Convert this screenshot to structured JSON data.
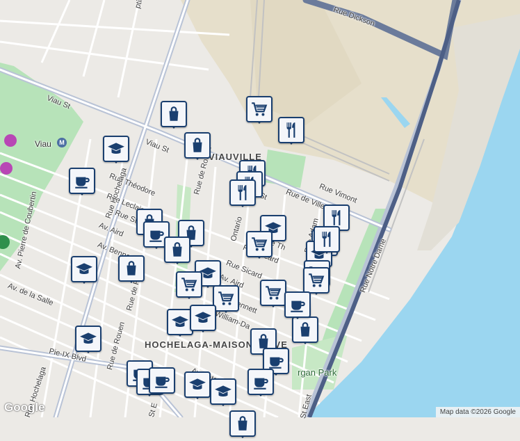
{
  "map": {
    "district_labels": [
      "VIAUVILLE",
      "HOCHELAGA-MAISONNEUVE"
    ],
    "metro_station": "Viau",
    "metro_badge": "M",
    "street_labels": [
      "Rue Dickson",
      "Viau St",
      "Viau St",
      "Rue Théodore",
      "Rue Leclaire",
      "Rue Sicard",
      "Av. Aird",
      "Av. Aird",
      "Av. Bennett",
      "Av. de la Salle",
      "Pie-IX Blvd",
      "Rue Hochelaga",
      "Rue Hochelaga",
      "Rue de Rouen",
      "Rue de Rouen",
      "Rue de Rouen",
      "Av. Pierre de Coubertin",
      "Ontario",
      "Rue de Ville",
      "Rue Vimont",
      "Rue Notre Dame",
      "William-Da",
      "Av. Letourne",
      "rgan Park",
      "St East",
      "St E",
      "Rue Sicard",
      "Rue Th",
      "Rue Adam",
      "Bennett",
      "Rue St",
      "ption Blvd",
      "St"
    ],
    "poi_markers": [
      {
        "type": "shopping",
        "icon": "shopping-bag-icon"
      },
      {
        "type": "grocery",
        "icon": "shopping-cart-icon"
      },
      {
        "type": "restaurant",
        "icon": "fork-knife-icon"
      },
      {
        "type": "shopping",
        "icon": "shopping-bag-icon"
      },
      {
        "type": "school",
        "icon": "graduation-cap-icon"
      },
      {
        "type": "cafe",
        "icon": "coffee-cup-icon"
      },
      {
        "type": "restaurant",
        "icon": "fork-knife-icon"
      },
      {
        "type": "restaurant",
        "icon": "fork-knife-icon"
      },
      {
        "type": "restaurant",
        "icon": "fork-knife-icon"
      },
      {
        "type": "shopping",
        "icon": "shopping-bag-icon"
      },
      {
        "type": "cafe",
        "icon": "coffee-cup-icon"
      },
      {
        "type": "shopping",
        "icon": "shopping-bag-icon"
      },
      {
        "type": "shopping",
        "icon": "shopping-bag-icon"
      },
      {
        "type": "school",
        "icon": "graduation-cap-icon"
      },
      {
        "type": "grocery",
        "icon": "shopping-cart-icon"
      },
      {
        "type": "restaurant",
        "icon": "fork-knife-icon"
      },
      {
        "type": "school",
        "icon": "graduation-cap-icon"
      },
      {
        "type": "shopping",
        "icon": "shopping-bag-icon"
      },
      {
        "type": "school",
        "icon": "graduation-cap-icon"
      },
      {
        "type": "shopping",
        "icon": "shopping-bag-icon"
      },
      {
        "type": "school",
        "icon": "graduation-cap-icon"
      },
      {
        "type": "grocery",
        "icon": "shopping-cart-icon"
      },
      {
        "type": "grocery",
        "icon": "shopping-cart-icon"
      },
      {
        "type": "grocery",
        "icon": "shopping-cart-icon"
      },
      {
        "type": "grocery",
        "icon": "shopping-cart-icon"
      },
      {
        "type": "grocery",
        "icon": "shopping-cart-icon"
      },
      {
        "type": "restaurant",
        "icon": "fork-knife-icon"
      },
      {
        "type": "shopping",
        "icon": "shopping-bag-icon"
      },
      {
        "type": "cafe",
        "icon": "coffee-cup-icon"
      },
      {
        "type": "school",
        "icon": "graduation-cap-icon"
      },
      {
        "type": "school",
        "icon": "graduation-cap-icon"
      },
      {
        "type": "shopping",
        "icon": "shopping-bag-icon"
      },
      {
        "type": "cafe",
        "icon": "coffee-cup-icon"
      },
      {
        "type": "school",
        "icon": "graduation-cap-icon"
      },
      {
        "type": "cafe",
        "icon": "coffee-cup-icon"
      },
      {
        "type": "cafe",
        "icon": "coffee-cup-icon"
      },
      {
        "type": "cafe",
        "icon": "coffee-cup-icon"
      },
      {
        "type": "school",
        "icon": "graduation-cap-icon"
      },
      {
        "type": "school",
        "icon": "graduation-cap-icon"
      },
      {
        "type": "cafe",
        "icon": "coffee-cup-icon"
      },
      {
        "type": "shopping",
        "icon": "shopping-bag-icon"
      }
    ],
    "colors": {
      "land": "#eceae6",
      "water": "#9bd6f0",
      "park": "#b7e3b9",
      "industrial": "#e6dfcb",
      "major_road": "#b9c3d6",
      "rail": "#c2c2c2",
      "marker_border": "#1a3f6f",
      "marker_bg": "#f4f6fa"
    },
    "google_logo": "Google",
    "attribution": "Map data ©2026 Google"
  }
}
